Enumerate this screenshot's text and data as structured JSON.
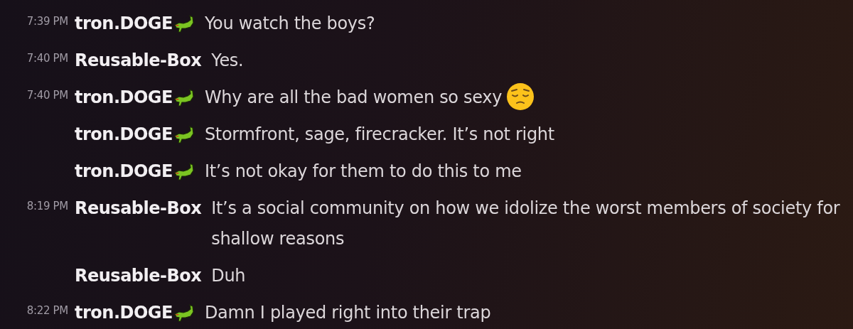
{
  "messages": [
    {
      "time": "7:39 PM",
      "author": "tron.DOGE",
      "badge": true,
      "text": "You watch the boys?",
      "emoji": false
    },
    {
      "time": "7:40 PM",
      "author": "Reusable-Box",
      "badge": false,
      "text": "Yes.",
      "emoji": false
    },
    {
      "time": "7:40 PM",
      "author": "tron.DOGE",
      "badge": true,
      "text": "Why are all the bad women so sexy",
      "emoji": true
    },
    {
      "author": "tron.DOGE",
      "badge": true,
      "text": "Stormfront, sage, firecracker. It’s not right",
      "emoji": false
    },
    {
      "author": "tron.DOGE",
      "badge": true,
      "text": "It’s not okay for them to do this to me",
      "emoji": false
    },
    {
      "time": "8:19 PM",
      "author": "Reusable-Box",
      "badge": false,
      "text": "It’s a social community on how we idolize the worst members of society for shallow reasons",
      "emoji": false
    },
    {
      "author": "Reusable-Box",
      "badge": false,
      "text": "Duh",
      "emoji": false
    },
    {
      "time": "8:22 PM",
      "author": "tron.DOGE",
      "badge": true,
      "text": "Damn I played right into their trap",
      "emoji": false
    }
  ]
}
